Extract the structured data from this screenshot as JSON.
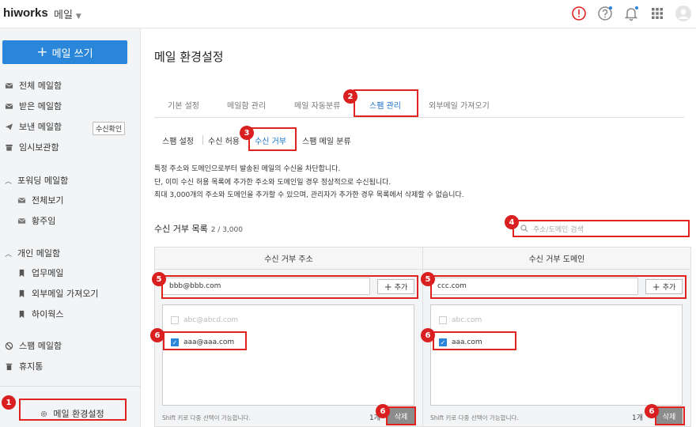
{
  "header": {
    "logo": "hiworks",
    "app_name": "메일"
  },
  "sidebar": {
    "compose_label": "메일 쓰기",
    "items": [
      {
        "label": "전체 메일함",
        "icon": "envelope-icon"
      },
      {
        "label": "받은 메일함",
        "icon": "envelope-icon"
      },
      {
        "label": "보낸 메일함",
        "icon": "send-icon"
      },
      {
        "label": "임시보관함",
        "icon": "archive-icon"
      }
    ],
    "read_check_label": "수신확인",
    "forwarding_section": "포워딩 메일함",
    "forwarding_items": [
      "전체보기",
      "황주임"
    ],
    "personal_section": "개인 메일함",
    "personal_items": [
      "업무메일",
      "외부메일 가져오기",
      "하이웍스"
    ],
    "spam_label": "스팸 메일함",
    "trash_label": "휴지통",
    "settings_label": "메일 환경설정"
  },
  "main": {
    "title": "메일 환경설정",
    "tabs": [
      "기본 설정",
      "메일함 관리",
      "메일 자동분류",
      "스팸 관리",
      "외부메일 가져오기"
    ],
    "subtabs": [
      "스팸 설정",
      "수신 허용",
      "수신 거부",
      "스팸 메일 분류"
    ],
    "description": [
      "특정 주소와 도메인으로부터 발송된 메일의 수신을 차단합니다.",
      "단, 이미 수신 허용 목록에 추가한 주소와 도메인일 경우 정상적으로 수신됩니다.",
      "최대 3,000개의 주소와 도메인을 추가할 수 있으며, 관리자가 추가한 경우 목록에서 삭제할 수 없습니다."
    ],
    "list_title": "수신 거부 목록",
    "list_count": "2 / 3,000",
    "search_placeholder": "주소/도메인 검색",
    "address_panel": {
      "header": "수신 거부 주소",
      "input_value": "bbb@bbb.com",
      "add_label": "추가",
      "entries": [
        {
          "text": "abc@abcd.com",
          "checked": false,
          "disabled": true
        },
        {
          "text": "aaa@aaa.com",
          "checked": true,
          "disabled": false
        }
      ],
      "hint": "Shift 키로 다중 선택이 가능합니다.",
      "selected_count": "1개",
      "delete_label": "삭제"
    },
    "domain_panel": {
      "header": "수신 거부 도메인",
      "input_value": "ccc.com",
      "add_label": "추가",
      "entries": [
        {
          "text": "abc.com",
          "checked": false,
          "disabled": true
        },
        {
          "text": "aaa.com",
          "checked": true,
          "disabled": false
        }
      ],
      "hint": "Shift 키로 다중 선택이 가능합니다.",
      "selected_count": "1개",
      "delete_label": "삭제"
    }
  },
  "callouts": [
    "1",
    "2",
    "3",
    "4",
    "5",
    "5",
    "6",
    "6",
    "6",
    "6"
  ],
  "colors": {
    "accent": "#2a86d8",
    "callout": "#e0231f",
    "sidebar_bg": "#f3f4f6"
  }
}
